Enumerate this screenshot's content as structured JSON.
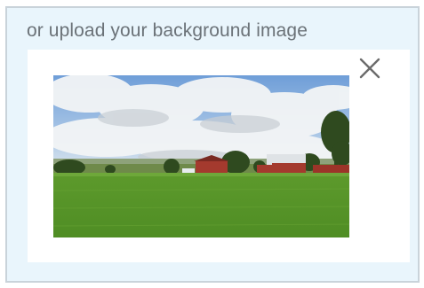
{
  "upload": {
    "heading": "or upload your background image"
  },
  "preview": {
    "image_subject": "farm landscape with red barns, green field and cloudy sky",
    "close_icon": "close-icon"
  },
  "colors": {
    "panel_background": "#e9f5fc",
    "panel_border": "#c9d3da",
    "heading_text": "#6b7278",
    "card_background": "#ffffff",
    "close_icon": "#6b6b6b"
  }
}
